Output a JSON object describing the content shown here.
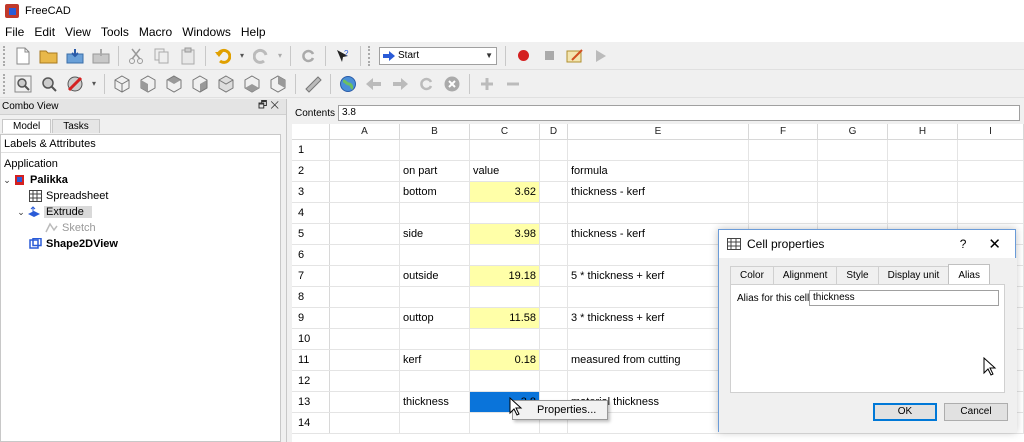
{
  "window": {
    "title": "FreeCAD"
  },
  "menu": [
    "File",
    "Edit",
    "View",
    "Tools",
    "Macro",
    "Windows",
    "Help"
  ],
  "toolbar": {
    "workbench_selected": "Start"
  },
  "combo_view": {
    "title": "Combo View",
    "tabs": [
      "Model",
      "Tasks"
    ],
    "labels_header": "Labels & Attributes",
    "tree": [
      {
        "label": "Application",
        "level": 0
      },
      {
        "label": "Palikka",
        "level": 1,
        "bold": true
      },
      {
        "label": "Spreadsheet",
        "level": 2
      },
      {
        "label": "Extrude",
        "level": 2,
        "selected": true
      },
      {
        "label": "Sketch",
        "level": 3,
        "greyed": true
      },
      {
        "label": "Shape2DView",
        "level": 2,
        "bold": true
      }
    ]
  },
  "contents": {
    "label": "Contents",
    "value": "3.8"
  },
  "sheet": {
    "columns": [
      "A",
      "B",
      "C",
      "D",
      "E",
      "F",
      "G",
      "H",
      "I"
    ],
    "rows": [
      {
        "n": "1",
        "b": "",
        "c": "",
        "e": ""
      },
      {
        "n": "2",
        "b": "on part",
        "c": "value",
        "e": "formula",
        "c_header": true
      },
      {
        "n": "3",
        "b": "bottom",
        "c": "3.62",
        "e": "thickness - kerf"
      },
      {
        "n": "4",
        "b": "",
        "c": "",
        "e": ""
      },
      {
        "n": "5",
        "b": "side",
        "c": "3.98",
        "e": "thickness - kerf"
      },
      {
        "n": "6",
        "b": "",
        "c": "",
        "e": ""
      },
      {
        "n": "7",
        "b": "outside",
        "c": "19.18",
        "e": "5 * thickness + kerf"
      },
      {
        "n": "8",
        "b": "",
        "c": "",
        "e": ""
      },
      {
        "n": "9",
        "b": "outtop",
        "c": "11.58",
        "e": "3 * thickness + kerf"
      },
      {
        "n": "10",
        "b": "",
        "c": "",
        "e": ""
      },
      {
        "n": "11",
        "b": "kerf",
        "c": "0.18",
        "e": "measured from cutting"
      },
      {
        "n": "12",
        "b": "",
        "c": "",
        "e": ""
      },
      {
        "n": "13",
        "b": "thickness",
        "c": "3.8",
        "e": "material thickness",
        "selected": true
      },
      {
        "n": "14",
        "b": "",
        "c": "",
        "e": ""
      }
    ]
  },
  "context_menu": {
    "item": "Properties..."
  },
  "dialog": {
    "title": "Cell properties",
    "help": "?",
    "close": "✕",
    "tabs": [
      "Color",
      "Alignment",
      "Style",
      "Display unit",
      "Alias"
    ],
    "alias_label": "Alias for this cell",
    "alias_value": "thickness",
    "ok": "OK",
    "cancel": "Cancel"
  }
}
